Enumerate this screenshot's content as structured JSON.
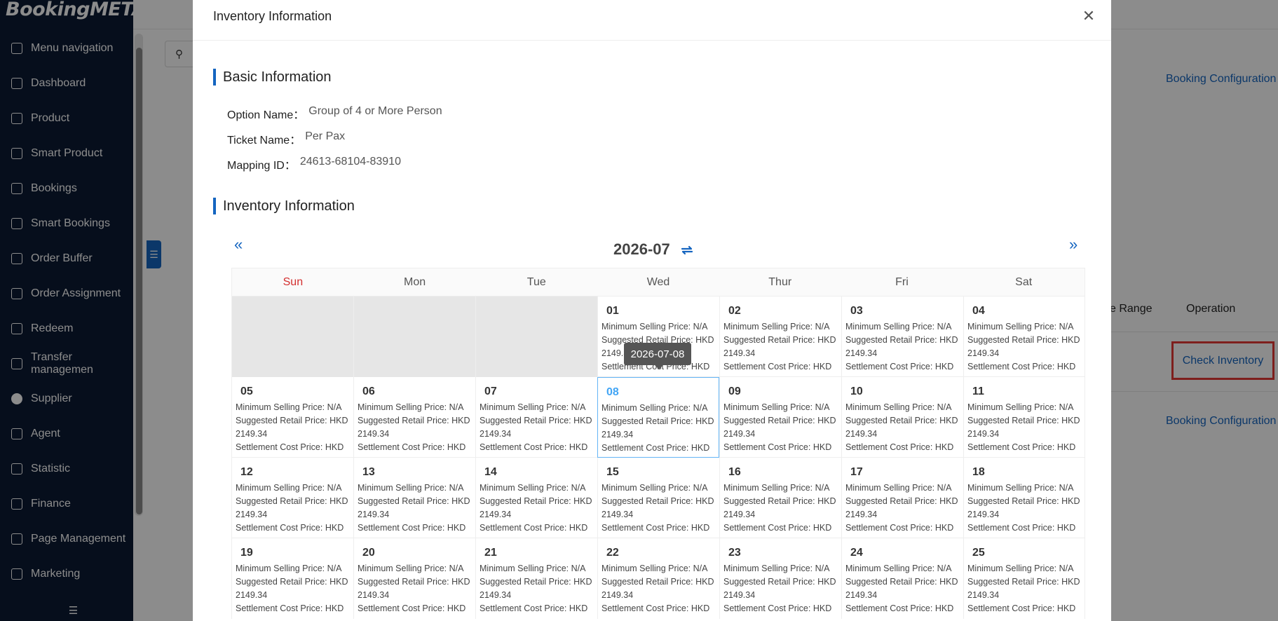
{
  "app": {
    "logo": "BookingMETA"
  },
  "sidebar": {
    "items": [
      {
        "label": "Menu navigation",
        "icon": "grid-icon"
      },
      {
        "label": "Dashboard",
        "icon": "home-icon"
      },
      {
        "label": "Product",
        "icon": "box-icon"
      },
      {
        "label": "Smart Product",
        "icon": "box-icon"
      },
      {
        "label": "Bookings",
        "icon": "document-icon"
      },
      {
        "label": "Smart Bookings",
        "icon": "document-icon"
      },
      {
        "label": "Order Buffer",
        "icon": "gear-icon"
      },
      {
        "label": "Order Assignment",
        "icon": "assign-icon"
      },
      {
        "label": "Redeem",
        "icon": "ticket-icon"
      },
      {
        "label": "Transfer managemen",
        "icon": "car-icon"
      },
      {
        "label": "Supplier",
        "icon": "supplier-icon"
      },
      {
        "label": "Agent",
        "icon": "agent-icon"
      },
      {
        "label": "Statistic",
        "icon": "chart-icon"
      },
      {
        "label": "Finance",
        "icon": "finance-icon"
      },
      {
        "label": "Page Management",
        "icon": "page-icon"
      },
      {
        "label": "Marketing",
        "icon": "marketing-icon"
      }
    ],
    "footer_icon": "collapse-icon"
  },
  "background": {
    "booking_config_1": "Booking Configuration",
    "booking_config_2": "Booking Configuration",
    "col_range": "e Range",
    "col_operation": "Operation",
    "check_inventory": "Check Inventory"
  },
  "modal": {
    "title": "Inventory Information",
    "basic_section": "Basic Information",
    "option_name_label": "Option Name：",
    "option_name_value": "Group of 4 or More Person",
    "ticket_name_label": "Ticket Name：",
    "ticket_name_value": "Per Pax",
    "mapping_id_label": "Mapping ID：",
    "mapping_id_value": "24613-68104-83910",
    "inventory_section": "Inventory Information"
  },
  "calendar": {
    "month": "2026-07",
    "weekdays": [
      "Sun",
      "Mon",
      "Tue",
      "Wed",
      "Thur",
      "Fri",
      "Sat"
    ],
    "line1": "Minimum Selling Price: N/A",
    "line2": "Suggested Retail Price: HKD",
    "line3": "2149.34",
    "line4": "Settlement Cost Price: HKD",
    "tooltip": "2026-07-08",
    "selected_day": "08",
    "weeks": [
      [
        "",
        "",
        "",
        "01",
        "02",
        "03",
        "04"
      ],
      [
        "05",
        "06",
        "07",
        "08",
        "09",
        "10",
        "11"
      ],
      [
        "12",
        "13",
        "14",
        "15",
        "16",
        "17",
        "18"
      ],
      [
        "19",
        "20",
        "21",
        "22",
        "23",
        "24",
        "25"
      ]
    ]
  }
}
